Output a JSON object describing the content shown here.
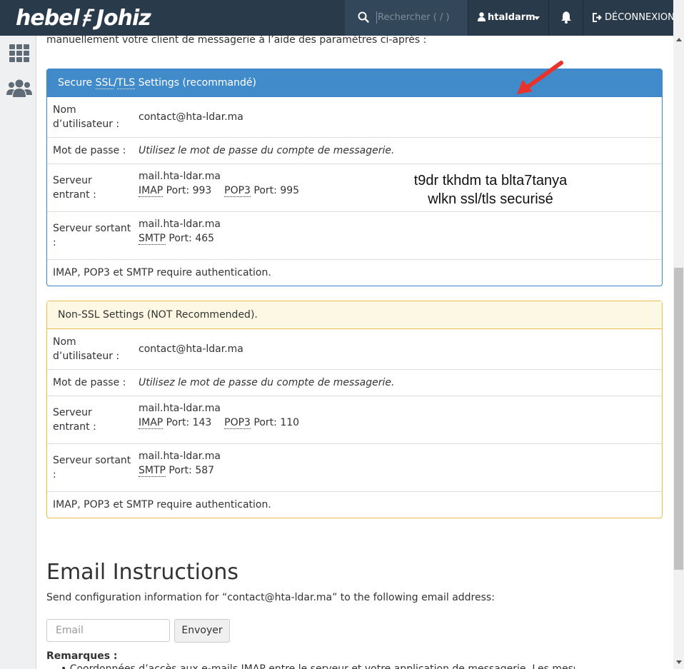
{
  "header": {
    "logo_left": "hebel",
    "logo_right": "Johiz",
    "search_placeholder": "Rechercher ( / )",
    "username": "htaldarm",
    "logout_label": "DÉCONNEXION"
  },
  "intro_text": "manuellement votre client de messagerie à l’aide des paramètres ci-après :",
  "ssl_panel": {
    "title_prefix": "Secure ",
    "title_abbr_ssl": "SSL",
    "title_sep": "/",
    "title_abbr_tls": "TLS",
    "title_suffix": " Settings (recommandé)",
    "username_label": "Nom d’utilisateur :",
    "username_value": "contact@hta-ldar.ma",
    "password_label": "Mot de passe :",
    "password_value": "Utilisez le mot de passe du compte de messagerie.",
    "incoming_label": "Serveur entrant :",
    "incoming_host": "mail.hta-ldar.ma",
    "imap_label": "IMAP",
    "imap_port": " Port: 993",
    "pop3_label": "POP3",
    "pop3_port": " Port: 995",
    "outgoing_label": "Serveur sortant :",
    "outgoing_host": "mail.hta-ldar.ma",
    "smtp_label": "SMTP",
    "smtp_port": " Port: 465",
    "auth_note": "IMAP, POP3 et SMTP require authentication."
  },
  "nonssl_panel": {
    "title": "Non-SSL Settings (NOT Recommended).",
    "username_label": "Nom d’utilisateur :",
    "username_value": "contact@hta-ldar.ma",
    "password_label": "Mot de passe :",
    "password_value": "Utilisez le mot de passe du compte de messagerie.",
    "incoming_label": "Serveur entrant :",
    "incoming_host": "mail.hta-ldar.ma",
    "imap_label": "IMAP",
    "imap_port": " Port: 143",
    "pop3_label": "POP3",
    "pop3_port": " Port: 110",
    "outgoing_label": "Serveur sortant :",
    "outgoing_host": "mail.hta-ldar.ma",
    "smtp_label": "SMTP",
    "smtp_port": " Port: 587",
    "auth_note": "IMAP, POP3 et SMTP require authentication."
  },
  "annotation": {
    "line1": "t9dr tkhdm ta blta7tanya",
    "line2": "wlkn ssl/tls securisé",
    "arrow_color": "#e8322c"
  },
  "email_instructions": {
    "title": "Email Instructions",
    "description": "Send configuration information for “contact@hta-ldar.ma” to the following email address:",
    "email_placeholder": "Email",
    "send_label": "Envoyer",
    "remarks_label": "Remarques :",
    "bullet_text": "Coordonnées d’accès aux e-mails IMAP entre le serveur et votre application de messagerie. Les messages"
  },
  "colors": {
    "topbar": "#293a4a",
    "primary": "#428bca",
    "warning_bg": "#fcf8e3",
    "warning_border": "#e8c04d"
  }
}
